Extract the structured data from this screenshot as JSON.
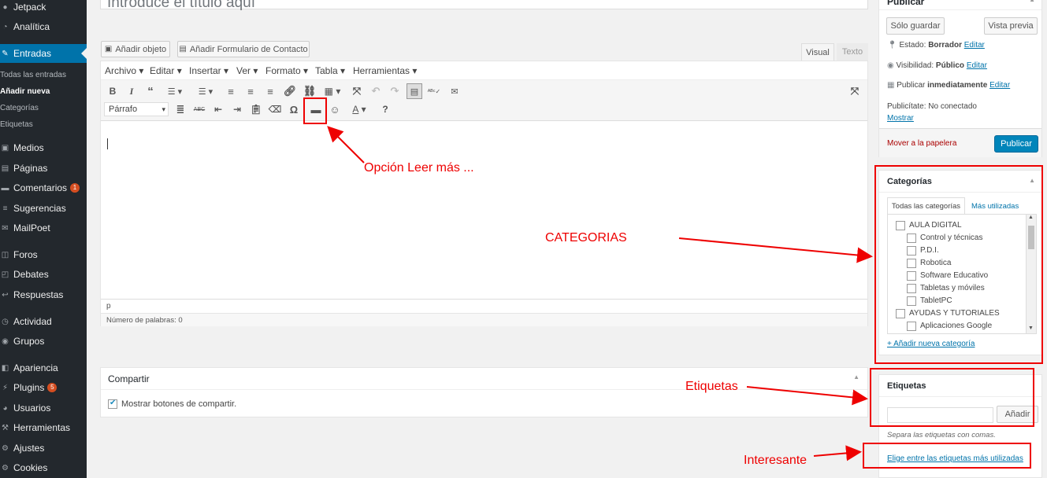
{
  "sidebar": {
    "items": [
      {
        "icon": "jetpack-icon",
        "glyph": "●",
        "label": "Jetpack"
      },
      {
        "icon": "analytics-icon",
        "glyph": "◔",
        "label": "Analítica"
      },
      {
        "icon": "pin-icon",
        "glyph": "✎",
        "label": "Entradas"
      },
      {
        "icon": "media-icon",
        "glyph": "▣",
        "label": "Medios"
      },
      {
        "icon": "pages-icon",
        "glyph": "▤",
        "label": "Páginas"
      },
      {
        "icon": "comments-icon",
        "glyph": "▬",
        "label": "Comentarios",
        "badge": "1"
      },
      {
        "icon": "feedback-icon",
        "glyph": "≡",
        "label": "Sugerencias"
      },
      {
        "icon": "mailpoet-icon",
        "glyph": "✉",
        "label": "MailPoet"
      },
      {
        "icon": "forums-icon",
        "glyph": "◫",
        "label": "Foros"
      },
      {
        "icon": "debates-icon",
        "glyph": "◰",
        "label": "Debates"
      },
      {
        "icon": "replies-icon",
        "glyph": "↩",
        "label": "Respuestas"
      },
      {
        "icon": "activity-icon",
        "glyph": "◷",
        "label": "Actividad"
      },
      {
        "icon": "groups-icon",
        "glyph": "◉",
        "label": "Grupos"
      },
      {
        "icon": "appearance-icon",
        "glyph": "◧",
        "label": "Apariencia"
      },
      {
        "icon": "plugins-icon",
        "glyph": "⚡",
        "label": "Plugins",
        "badge": "5"
      },
      {
        "icon": "users-icon",
        "glyph": "◕",
        "label": "Usuarios"
      },
      {
        "icon": "tools-icon",
        "glyph": "⚒",
        "label": "Herramientas"
      },
      {
        "icon": "settings-icon",
        "glyph": "⚙",
        "label": "Ajustes"
      },
      {
        "icon": "cookies-icon",
        "glyph": "⚙",
        "label": "Cookies"
      }
    ],
    "submenu": [
      "Todas las entradas",
      "Añadir nueva",
      "Categorías",
      "Etiquetas"
    ]
  },
  "editor": {
    "title_placeholder": "Introduce el título aquí",
    "add_media": "Añadir objeto",
    "add_form": "Añadir Formulario de Contacto",
    "tab_visual": "Visual",
    "tab_text": "Texto",
    "menus": [
      "Archivo",
      "Editar",
      "Insertar",
      "Ver",
      "Formato",
      "Tabla",
      "Herramientas"
    ],
    "format_select": "Párrafo",
    "path": "p",
    "word_count": "Número de palabras: 0"
  },
  "share": {
    "title": "Compartir",
    "checkbox_label": "Mostrar botones de compartir."
  },
  "publish": {
    "title": "Publicar",
    "save_draft": "Sólo guardar",
    "preview": "Vista previa",
    "status_label": "Estado:",
    "status_value": "Borrador",
    "visibility_label": "Visibilidad:",
    "visibility_value": "Público",
    "schedule_label": "Publicar",
    "schedule_value": "inmediatamente",
    "edit": "Editar",
    "publicize": "Publicítate: No conectado",
    "show": "Mostrar",
    "trash": "Mover a la papelera",
    "publish_button": "Publicar"
  },
  "categories": {
    "title": "Categorías",
    "tab_all": "Todas las categorías",
    "tab_popular": "Más utilizadas",
    "items": [
      {
        "label": "AULA DIGITAL",
        "level": 0
      },
      {
        "label": "Control y técnicas",
        "level": 1
      },
      {
        "label": "P.D.I.",
        "level": 1
      },
      {
        "label": "Robotica",
        "level": 1
      },
      {
        "label": "Software Educativo",
        "level": 1
      },
      {
        "label": "Tabletas y móviles",
        "level": 1
      },
      {
        "label": "TabletPC",
        "level": 1
      },
      {
        "label": "AYUDAS Y TUTORIALES",
        "level": 0
      },
      {
        "label": "Aplicaciones Google",
        "level": 1
      }
    ],
    "add_new": "+ Añadir nueva categoría"
  },
  "tags": {
    "title": "Etiquetas",
    "add_button": "Añadir",
    "hint": "Separa las etiquetas con comas.",
    "choose_popular": "Elige entre las etiquetas más utilizadas"
  },
  "annotations": {
    "read_more": "Opción Leer más ...",
    "categories": "CATEGORIAS",
    "tags": "Etiquetas",
    "interesting": "Interesante"
  },
  "colors": {
    "accent": "#0073aa",
    "annotation": "#e00000",
    "sidebar": "#23282d"
  }
}
